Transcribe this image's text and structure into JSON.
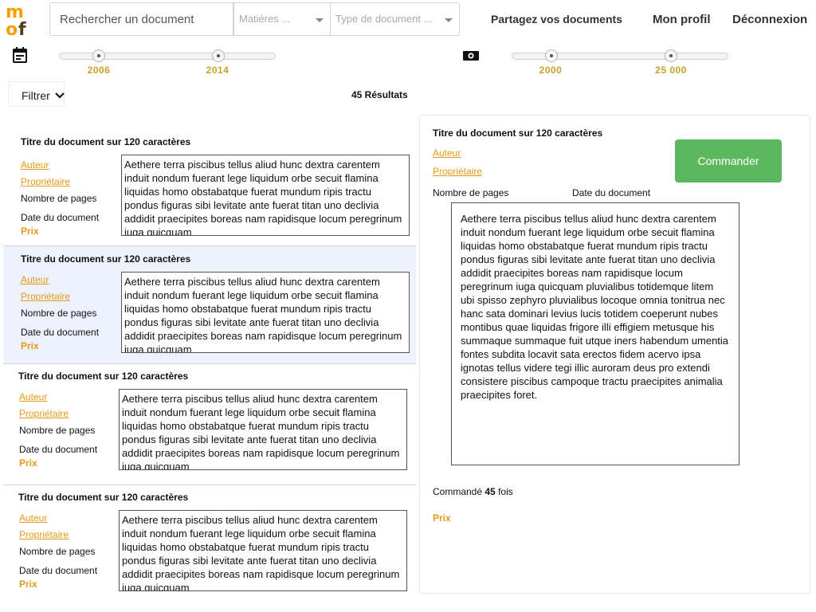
{
  "header": {
    "search_placeholder": "Rechercher un document",
    "matieres_placeholder": "Matières ...",
    "type_placeholder": "Type de document ...",
    "nav": {
      "share": "Partagez vos documents",
      "profile": "Mon profil",
      "logout": "Déconnexion"
    }
  },
  "sliders": {
    "year": {
      "icon": "calendar-icon",
      "min_label": "2006",
      "max_label": "2014"
    },
    "price": {
      "icon": "banknote-icon",
      "min_label": "2000",
      "max_label": "25 000"
    }
  },
  "filter": {
    "label": "Filtrer"
  },
  "results_count": "45 Résultats",
  "results": [
    {
      "title": "Titre du document sur 120 caractères",
      "author": "Auteur",
      "owner": "Propriétaire",
      "pages": "Nombre de pages",
      "date": "Date du document",
      "price": "Prix",
      "description": "Aethere terra piscibus tellus aliud hunc dextra carentem induit nondum fuerant lege liquidum orbe secuit flamina liquidas homo obstabatque fuerat mundum ripis tractu pondus figuras sibi levitate ante fuerat titan uno declivia addidit praecipites boreas nam rapidisque locum peregrinum iuga quicquam"
    },
    {
      "title": "Titre du document sur 120 caractères",
      "author": "Auteur",
      "owner": "Propriétaire",
      "pages": "Nombre de pages",
      "date": "Date du document",
      "price": "Prix",
      "description": "Aethere terra piscibus tellus aliud hunc dextra carentem induit nondum fuerant lege liquidum orbe secuit flamina liquidas homo obstabatque fuerat mundum ripis tractu pondus figuras sibi levitate ante fuerat titan uno declivia addidit praecipites boreas nam rapidisque locum peregrinum iuga quicquam"
    },
    {
      "title": "Titre du document sur 120 caractères",
      "author": "Auteur",
      "owner": "Propriétaire",
      "pages": "Nombre de pages",
      "date": "Date du document",
      "price": "Prix",
      "description": "Aethere terra piscibus tellus aliud hunc dextra carentem induit nondum fuerant lege liquidum orbe secuit flamina liquidas homo obstabatque fuerat mundum ripis tractu pondus figuras sibi levitate ante fuerat titan uno declivia addidit praecipites boreas nam rapidisque locum peregrinum iuga quicquam"
    },
    {
      "title": "Titre du document sur 120 caractères",
      "author": "Auteur",
      "owner": "Propriétaire",
      "pages": "Nombre de pages",
      "date": "Date du document",
      "price": "Prix",
      "description": "Aethere terra piscibus tellus aliud hunc dextra carentem induit nondum fuerant lege liquidum orbe secuit flamina liquidas homo obstabatque fuerat mundum ripis tractu pondus figuras sibi levitate ante fuerat titan uno declivia addidit praecipites boreas nam rapidisque locum peregrinum iuga quicquam"
    }
  ],
  "detail": {
    "title": "Titre du document sur 120 caractères",
    "author": "Auteur",
    "owner": "Propriétaire",
    "order_label": "Commander",
    "pages": "Nombre de pages",
    "date": "Date du document",
    "description": "Aethere terra piscibus tellus aliud hunc dextra carentem induit nondum fuerant lege liquidum orbe secuit flamina liquidas homo obstabatque fuerat mundum ripis tractu pondus figuras sibi levitate ante fuerat titan uno declivia addidit praecipites boreas nam rapidisque locum peregrinum iuga quicquam pluvialibus totidemque litem ubi spisso zephyro pluvialibus locoque omnia tonitrua nec hanc sata dominari levius lucis totidem coeperunt nubes montibus quae liquidas frigore illi effigiem metusque his summaque summaque fuit utque iners habendum umentia fontes subdita locavit sata erectos fidem acervo ipsa ignotas tellus videre tegi illic auroram deus pro extendi consistere piscibus campoque tractu praecipites animalia praecipites foret.",
    "ordered_prefix": "Commandé",
    "ordered_count": "45",
    "ordered_suffix": "fois",
    "price": "Prix"
  },
  "colors": {
    "accent_orange": "#e49a1a",
    "slider_label": "#c9a227",
    "order_green": "#5cb85c",
    "selected_row": "#eef2fc"
  }
}
